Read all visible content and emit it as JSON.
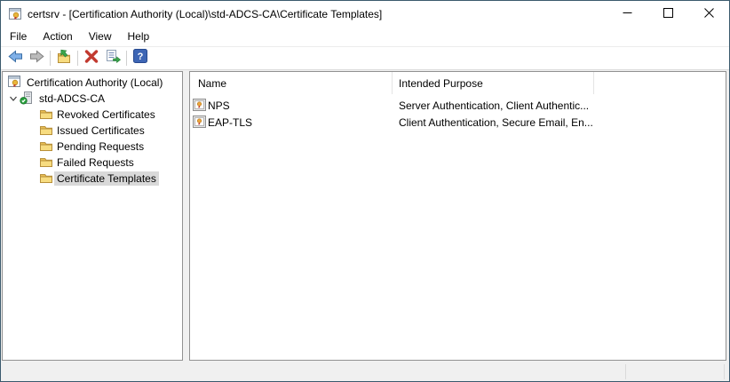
{
  "window": {
    "title": "certsrv - [Certification Authority (Local)\\std-ADCS-CA\\Certificate Templates]",
    "icon": "certsrv-icon",
    "controls": [
      {
        "name": "minimize",
        "icon": "minimize-icon"
      },
      {
        "name": "maximize",
        "icon": "maximize-icon"
      },
      {
        "name": "close",
        "icon": "close-icon"
      }
    ]
  },
  "menu": {
    "items": [
      {
        "label": "File"
      },
      {
        "label": "Action"
      },
      {
        "label": "View"
      },
      {
        "label": "Help"
      }
    ]
  },
  "toolbar": {
    "buttons": [
      {
        "name": "back",
        "icon": "back-arrow-icon"
      },
      {
        "name": "forward",
        "icon": "forward-arrow-icon",
        "disabled": true
      },
      {
        "name": "up-one-level",
        "icon": "folder-up-icon"
      },
      {
        "name": "delete",
        "icon": "red-x-icon"
      },
      {
        "name": "export-list",
        "icon": "export-list-icon"
      },
      {
        "name": "help",
        "icon": "help-icon"
      }
    ]
  },
  "tree": {
    "root": {
      "label": "Certification Authority (Local)",
      "icon": "certsrv-icon"
    },
    "ca_node": {
      "label": "std-ADCS-CA",
      "icon": "ca-server-icon",
      "expanded": true
    },
    "children": [
      {
        "label": "Revoked Certificates",
        "icon": "folder-icon",
        "selected": false
      },
      {
        "label": "Issued Certificates",
        "icon": "folder-icon",
        "selected": false
      },
      {
        "label": "Pending Requests",
        "icon": "folder-icon",
        "selected": false
      },
      {
        "label": "Failed Requests",
        "icon": "folder-icon",
        "selected": false
      },
      {
        "label": "Certificate Templates",
        "icon": "folder-icon",
        "selected": true
      }
    ]
  },
  "list": {
    "columns": [
      {
        "label": "Name"
      },
      {
        "label": "Intended Purpose"
      }
    ],
    "rows": [
      {
        "icon": "certificate-template-icon",
        "name": "NPS",
        "intended_purpose": "Server Authentication, Client Authentic..."
      },
      {
        "icon": "certificate-template-icon",
        "name": "EAP-TLS",
        "intended_purpose": "Client Authentication, Secure Email, En..."
      }
    ]
  },
  "colors": {
    "window_border": "#3b5a6d",
    "selection_inactive": "#d9d9d9",
    "pane_border": "#919191",
    "content_background": "#f0f0f0",
    "titlebar_background": "#ffffff"
  }
}
